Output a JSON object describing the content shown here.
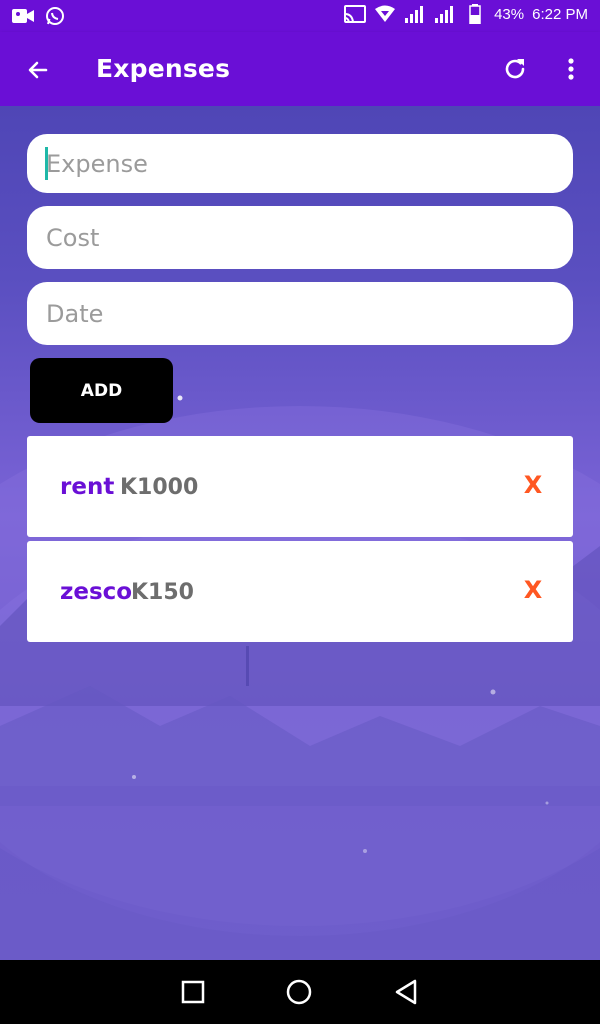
{
  "status_bar": {
    "battery_percent": "43%",
    "time": "6:22 PM",
    "icons": [
      "video-camera-icon",
      "whatsapp-icon",
      "cast-icon",
      "wifi-icon",
      "signal-icon",
      "signal-icon",
      "battery-icon"
    ]
  },
  "app_bar": {
    "title": "Expenses",
    "back_icon": "arrow-left-icon",
    "refresh_icon": "refresh-icon",
    "more_icon": "more-vertical-icon",
    "background": "#6a0fd6"
  },
  "form": {
    "expense": {
      "placeholder": "Expense",
      "value": ""
    },
    "cost": {
      "placeholder": "Cost",
      "value": ""
    },
    "date": {
      "placeholder": "Date",
      "value": ""
    },
    "add_label": "ADD"
  },
  "expenses": [
    {
      "name": "rent",
      "cost": "K1000",
      "delete_label": "X"
    },
    {
      "name": "zesco",
      "cost": "K150",
      "delete_label": "X"
    }
  ],
  "nav_bar": {
    "icons": [
      "recents-square-icon",
      "home-circle-icon",
      "back-triangle-icon"
    ]
  },
  "colors": {
    "accent": "#6a0fd6",
    "delete": "#ff5722",
    "cost_text": "#6d6d6d"
  }
}
